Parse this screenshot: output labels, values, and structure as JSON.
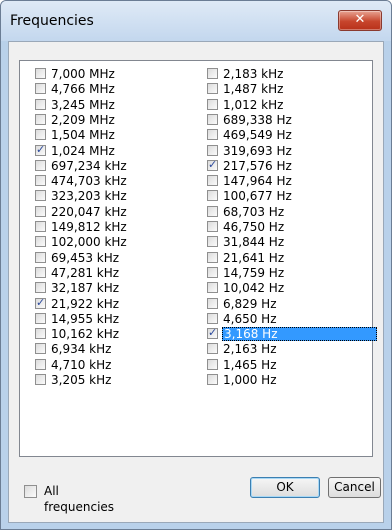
{
  "window": {
    "title": "Frequencies",
    "close_glyph": "✕"
  },
  "list": {
    "column1": [
      {
        "label": "7,000 MHz",
        "checked": false
      },
      {
        "label": "4,766 MHz",
        "checked": false
      },
      {
        "label": "3,245 MHz",
        "checked": false
      },
      {
        "label": "2,209 MHz",
        "checked": false
      },
      {
        "label": "1,504 MHz",
        "checked": false
      },
      {
        "label": "1,024 MHz",
        "checked": true
      },
      {
        "label": "697,234 kHz",
        "checked": false
      },
      {
        "label": "474,703 kHz",
        "checked": false
      },
      {
        "label": "323,203 kHz",
        "checked": false
      },
      {
        "label": "220,047 kHz",
        "checked": false
      },
      {
        "label": "149,812 kHz",
        "checked": false
      },
      {
        "label": "102,000 kHz",
        "checked": false
      },
      {
        "label": "69,453 kHz",
        "checked": false
      },
      {
        "label": "47,281 kHz",
        "checked": false
      },
      {
        "label": "32,187 kHz",
        "checked": false
      },
      {
        "label": "21,922 kHz",
        "checked": true
      },
      {
        "label": "14,955 kHz",
        "checked": false
      },
      {
        "label": "10,162 kHz",
        "checked": false
      },
      {
        "label": "6,934 kHz",
        "checked": false
      },
      {
        "label": "4,710 kHz",
        "checked": false
      },
      {
        "label": "3,205 kHz",
        "checked": false
      }
    ],
    "column2": [
      {
        "label": "2,183 kHz",
        "checked": false
      },
      {
        "label": "1,487 kHz",
        "checked": false
      },
      {
        "label": "1,012 kHz",
        "checked": false
      },
      {
        "label": "689,338 Hz",
        "checked": false
      },
      {
        "label": "469,549 Hz",
        "checked": false
      },
      {
        "label": "319,693 Hz",
        "checked": false
      },
      {
        "label": "217,576 Hz",
        "checked": true
      },
      {
        "label": "147,964 Hz",
        "checked": false
      },
      {
        "label": "100,677 Hz",
        "checked": false
      },
      {
        "label": "68,703 Hz",
        "checked": false
      },
      {
        "label": "46,750 Hz",
        "checked": false
      },
      {
        "label": "31,844 Hz",
        "checked": false
      },
      {
        "label": "21,641 Hz",
        "checked": false
      },
      {
        "label": "14,759 Hz",
        "checked": false
      },
      {
        "label": "10,042 Hz",
        "checked": false
      },
      {
        "label": "6,829 Hz",
        "checked": false
      },
      {
        "label": "4,650 Hz",
        "checked": false
      },
      {
        "label": "3,168 Hz",
        "checked": true,
        "selected": true
      },
      {
        "label": "2,163 Hz",
        "checked": false
      },
      {
        "label": "1,465 Hz",
        "checked": false
      },
      {
        "label": "1,000 Hz",
        "checked": false
      }
    ]
  },
  "footer": {
    "all_frequencies_label": "All frequencies",
    "all_frequencies_checked": false,
    "ok_label": "OK",
    "cancel_label": "Cancel"
  },
  "colors": {
    "selection": "#3399ff",
    "close_button": "#c7452c"
  }
}
